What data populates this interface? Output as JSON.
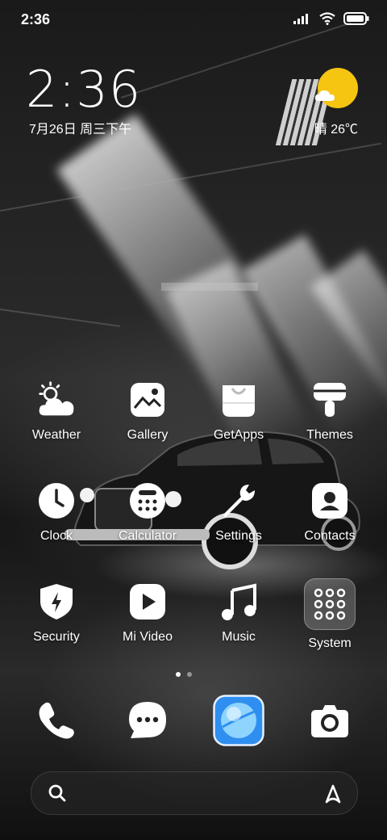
{
  "status_bar": {
    "time": "2:36"
  },
  "clock_widget": {
    "time": "2:36",
    "date": "7月26日 周三下午"
  },
  "weather_widget": {
    "text": "晴 26℃"
  },
  "apps": [
    {
      "id": "weather",
      "label": "Weather"
    },
    {
      "id": "gallery",
      "label": "Gallery"
    },
    {
      "id": "getapps",
      "label": "GetApps"
    },
    {
      "id": "themes",
      "label": "Themes"
    },
    {
      "id": "clock",
      "label": "Clock"
    },
    {
      "id": "calculator",
      "label": "Calculator"
    },
    {
      "id": "settings",
      "label": "Settings"
    },
    {
      "id": "contacts",
      "label": "Contacts"
    },
    {
      "id": "security",
      "label": "Security"
    },
    {
      "id": "mi_video",
      "label": "Mi Video"
    },
    {
      "id": "music",
      "label": "Music"
    },
    {
      "id": "system",
      "label": "System"
    }
  ],
  "dock": [
    "phone-icon",
    "messages-icon",
    "browser-icon",
    "camera-icon"
  ],
  "colors": {
    "sun": "#f6c511",
    "browser": "#2f8ff0"
  }
}
